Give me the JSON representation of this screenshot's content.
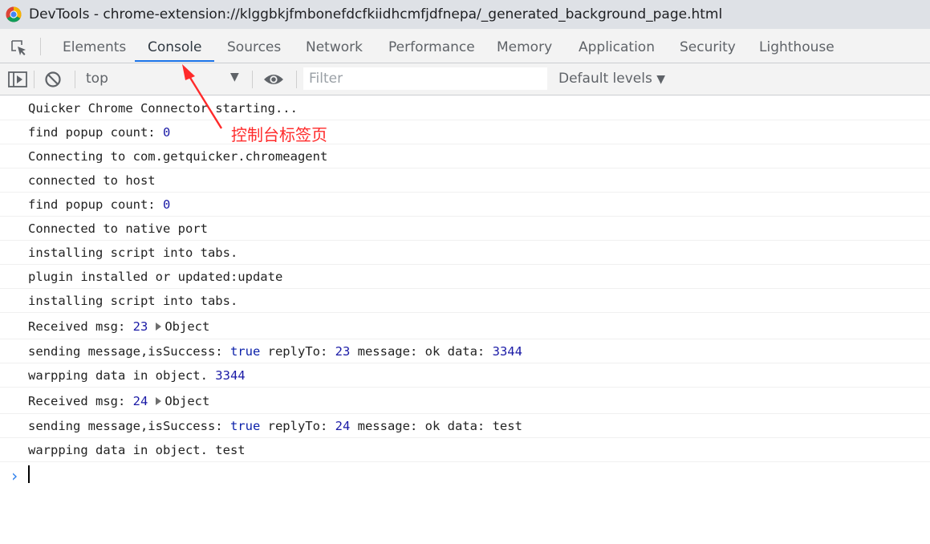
{
  "window": {
    "title": "DevTools - chrome-extension://klggbkjfmbonefdcfkiidhcmfjdfnepa/_generated_background_page.html"
  },
  "tabs": [
    {
      "label": "Elements"
    },
    {
      "label": "Console"
    },
    {
      "label": "Sources"
    },
    {
      "label": "Network"
    },
    {
      "label": "Performance"
    },
    {
      "label": "Memory"
    },
    {
      "label": "Application"
    },
    {
      "label": "Security"
    },
    {
      "label": "Lighthouse"
    }
  ],
  "active_tab": "Console",
  "toolbar": {
    "context": "top",
    "filter_placeholder": "Filter",
    "levels": "Default levels"
  },
  "console_lines": [
    {
      "t": "Quicker Chrome Connector starting..."
    },
    {
      "t": "find popup count: ",
      "n": "0"
    },
    {
      "t": "Connecting to com.getquicker.chromeagent"
    },
    {
      "t": "connected to host"
    },
    {
      "t": "find popup count: ",
      "n": "0"
    },
    {
      "t": "Connected to native port"
    },
    {
      "t": "installing script into tabs."
    },
    {
      "t": "plugin installed or updated:update"
    },
    {
      "t": "installing script into tabs."
    },
    {
      "t": "Received msg: ",
      "n": "23",
      "obj": "Object"
    },
    {
      "t": "sending message,isSuccess: ",
      "b": "true",
      "t2": " replyTo: ",
      "n": "23",
      "t3": " message: ok data: ",
      "n2": "3344"
    },
    {
      "t": "warpping data in object. ",
      "n": "3344"
    },
    {
      "t": "Received msg: ",
      "n": "24",
      "obj": "Object"
    },
    {
      "t": "sending message,isSuccess: ",
      "b": "true",
      "t2": " replyTo: ",
      "n": "24",
      "t3": " message: ok data: test"
    },
    {
      "t": "warpping data in object. test"
    }
  ],
  "annotation": {
    "text": "控制台标签页",
    "color": "#ff2a2a"
  },
  "colors": {
    "accent": "#1a73e8",
    "number": "#1a1aa6",
    "boolean": "#0d22aa"
  }
}
